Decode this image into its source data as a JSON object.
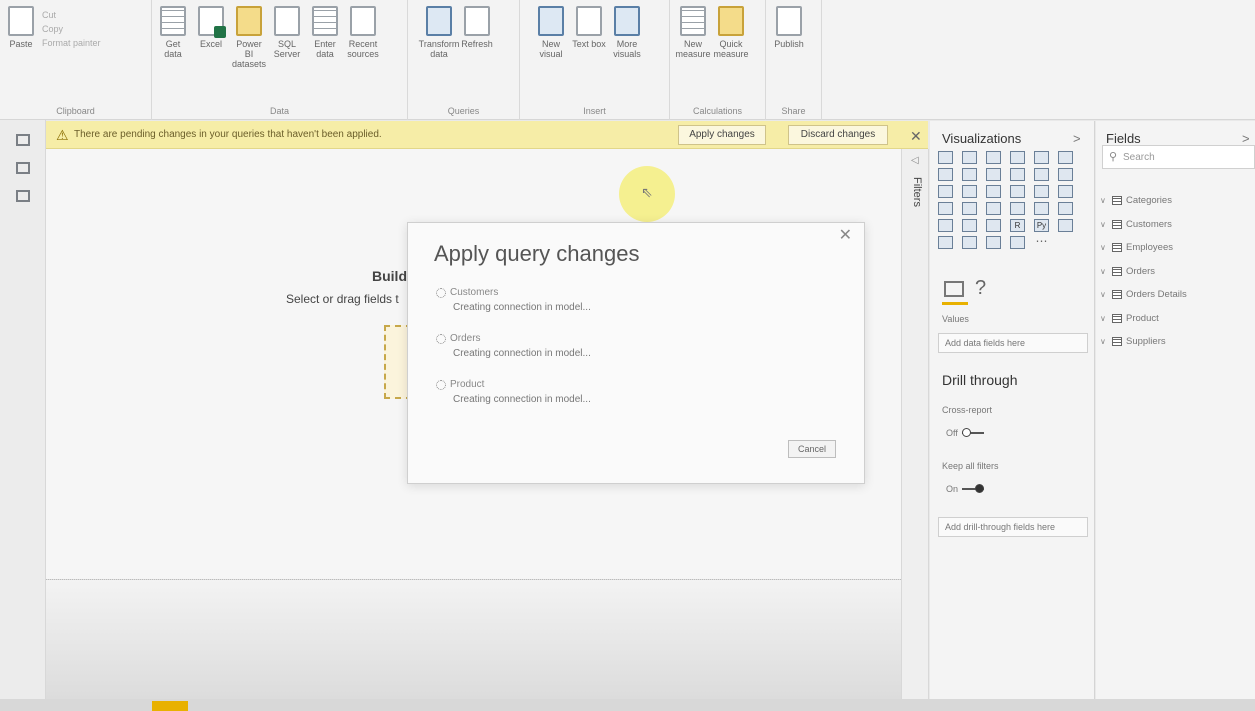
{
  "ribbon": {
    "groups": [
      {
        "name": "Clipboard",
        "buttons": [
          "Paste"
        ],
        "small": [
          "Cut",
          "Copy",
          "Format painter"
        ]
      },
      {
        "name": "Data",
        "buttons": [
          "Get data",
          "Excel",
          "Power BI datasets",
          "SQL Server",
          "Enter data",
          "Recent sources"
        ]
      },
      {
        "name": "Queries",
        "buttons": [
          "Transform data",
          "Refresh"
        ]
      },
      {
        "name": "Insert",
        "buttons": [
          "New visual",
          "Text box",
          "More visuals"
        ]
      },
      {
        "name": "Calculations",
        "buttons": [
          "New measure",
          "Quick measure"
        ]
      },
      {
        "name": "Share",
        "buttons": [
          "Publish"
        ]
      }
    ]
  },
  "warning": {
    "text": "There are pending changes in your queries that haven't been applied.",
    "apply_label": "Apply changes",
    "discard_label": "Discard changes"
  },
  "canvas": {
    "build_text": "Build",
    "select_text": "Select or drag fields t"
  },
  "dialog": {
    "title": "Apply query changes",
    "items": [
      {
        "name": "Customers",
        "status": "Creating connection in model..."
      },
      {
        "name": "Orders",
        "status": "Creating connection in model..."
      },
      {
        "name": "Product",
        "status": "Creating connection in model..."
      }
    ],
    "cancel_label": "Cancel"
  },
  "filters_label": "Filters",
  "visualizations": {
    "title": "Visualizations",
    "values_label": "Values",
    "values_well": "Add data fields here",
    "drill_title": "Drill through",
    "cross_report_label": "Cross-report",
    "cross_report_state": "Off",
    "keep_filters_label": "Keep all filters",
    "keep_filters_state": "On",
    "drill_well": "Add drill-through fields here",
    "r_icon": "R",
    "py_icon": "Py",
    "more_icon": "⋯"
  },
  "fields": {
    "title": "Fields",
    "search_placeholder": "Search",
    "tables": [
      "Categories",
      "Customers",
      "Employees",
      "Orders",
      "Orders Details",
      "Product",
      "Suppliers"
    ]
  }
}
